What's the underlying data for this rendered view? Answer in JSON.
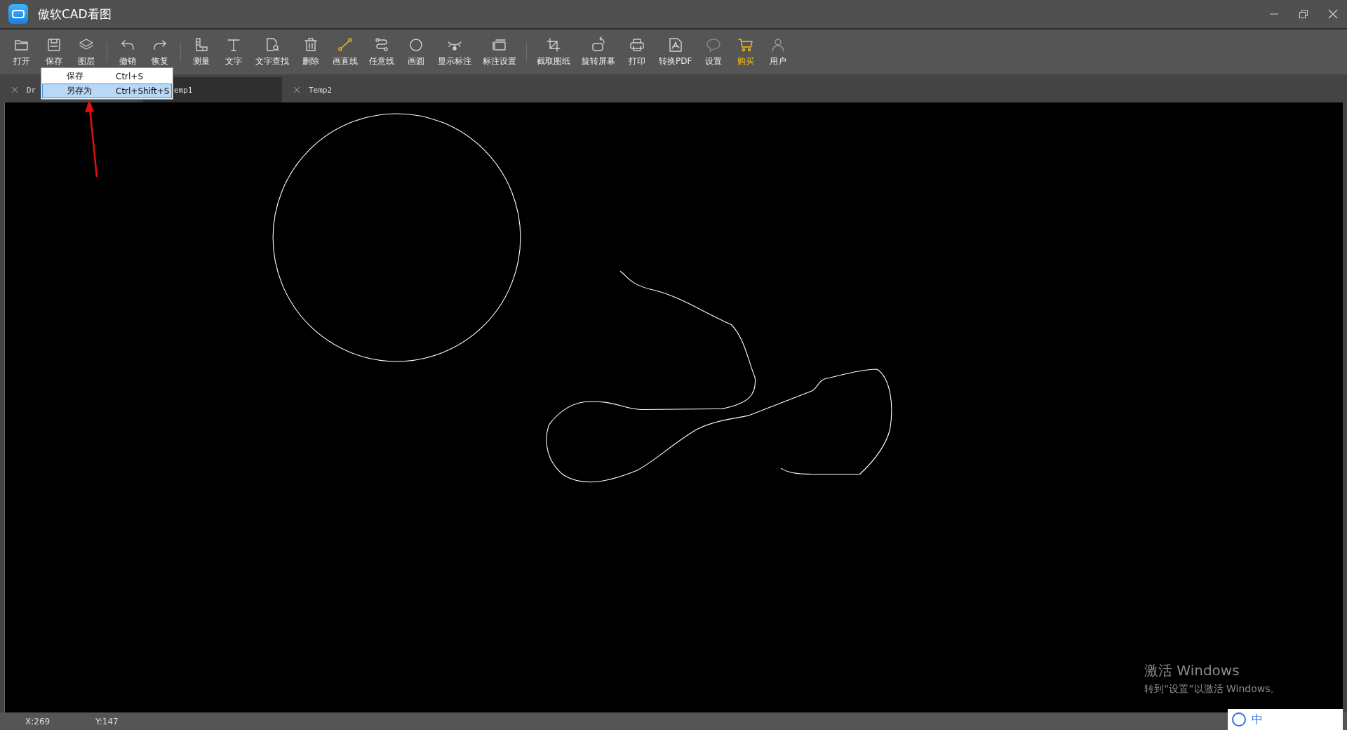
{
  "window": {
    "title": "傲软CAD看图"
  },
  "toolbar": {
    "groups": [
      [
        {
          "label": "打开",
          "kind": "folder"
        },
        {
          "label": "保存",
          "kind": "save"
        },
        {
          "label": "图层",
          "kind": "layers"
        }
      ],
      [
        {
          "label": "撤销",
          "kind": "undo"
        },
        {
          "label": "恢复",
          "kind": "redo"
        }
      ],
      [
        {
          "label": "测量",
          "kind": "ruler"
        },
        {
          "label": "文字",
          "kind": "text"
        },
        {
          "label": "文字查找",
          "kind": "find"
        },
        {
          "label": "删除",
          "kind": "trash"
        },
        {
          "label": "画直线",
          "kind": "line"
        },
        {
          "label": "任意线",
          "kind": "polyline"
        },
        {
          "label": "画圆",
          "kind": "circle"
        },
        {
          "label": "显示标注",
          "kind": "eye"
        },
        {
          "label": "标注设置",
          "kind": "frames"
        }
      ],
      [
        {
          "label": "截取图纸",
          "kind": "crop"
        },
        {
          "label": "旋转屏幕",
          "kind": "rotate"
        },
        {
          "label": "打印",
          "kind": "printer"
        },
        {
          "label": "转换PDF",
          "kind": "pdf"
        },
        {
          "label": "设置",
          "kind": "chat"
        },
        {
          "label": "购买",
          "kind": "cart",
          "highlight": true
        },
        {
          "label": "用户",
          "kind": "user"
        }
      ]
    ]
  },
  "tabs": [
    {
      "label": "Dr",
      "selected": false
    },
    {
      "label": "emp1",
      "selected": true
    },
    {
      "label": "Temp2",
      "selected": false
    }
  ],
  "save_menu": {
    "items": [
      {
        "label": "保存",
        "shortcut": "Ctrl+S",
        "selected": false
      },
      {
        "label": "另存为",
        "shortcut": "Ctrl+Shift+S",
        "selected": true
      }
    ]
  },
  "activation_notice": {
    "title": "激活 Windows",
    "text": "转到“设置”以激活 Windows。"
  },
  "status_bar": {
    "x": "X:269",
    "y": "Y:147"
  },
  "ime_bar": {
    "mode": "中"
  }
}
